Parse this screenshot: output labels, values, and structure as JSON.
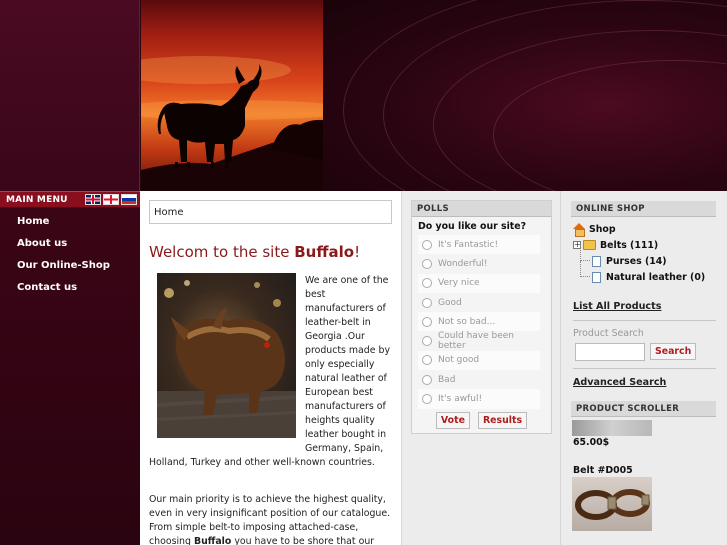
{
  "sidebar": {
    "title": "MAIN MENU",
    "languages": [
      "English",
      "Georgian",
      "Russian"
    ],
    "items": [
      {
        "label": "Home"
      },
      {
        "label": "About us"
      },
      {
        "label": "Our Online-Shop"
      },
      {
        "label": "Contact us"
      }
    ]
  },
  "content": {
    "breadcrumb": "Home",
    "welcome_prefix": "Welcom to the site ",
    "welcome_brand": "Buffalo",
    "welcome_suffix": "!",
    "intro": "We are one of the best manufacturers of leather-belt in Georgia .Our products made by only especially natural leather of European best manufacturers of heights quality leather bought in Germany, Spain, Holland, Turkey and other well-known countries.",
    "priority_part1": "Our main priority is to achieve the highest quality, even in very insignificant position of our catalogue. From simple belt-to imposing attached-case, choosing ",
    "priority_brand": "Buffalo",
    "priority_part2": " you have to be shore that our"
  },
  "polls": {
    "title": "POLLS",
    "question": "Do you like our site?",
    "options": [
      "It's Fantastic!",
      "Wonderful!",
      "Very nice",
      "Good",
      "Not so bad...",
      "Could have been better",
      "Not good",
      "Bad",
      "It's awful!"
    ],
    "vote_label": "Vote",
    "results_label": "Results"
  },
  "shop": {
    "title": "ONLINE SHOP",
    "root": "Shop",
    "categories": [
      {
        "label": "Belts (111)",
        "expandable": true
      },
      {
        "label": "Purses (14)",
        "expandable": false
      },
      {
        "label": "Natural leather (0)",
        "expandable": false
      }
    ],
    "list_all": "List All Products",
    "search_label": "Product Search",
    "search_value": "",
    "search_button": "Search",
    "advanced_search": "Advanced Search"
  },
  "scroller": {
    "title": "PRODUCT SCROLLER",
    "price": "65.00$",
    "product_name": "Belt #D005"
  },
  "colors": {
    "menu_bar": "#8a0f1e",
    "welcome_text": "#8a1a1a",
    "button_text": "#b01c1c",
    "sidebar_bg": "#3c0516"
  }
}
